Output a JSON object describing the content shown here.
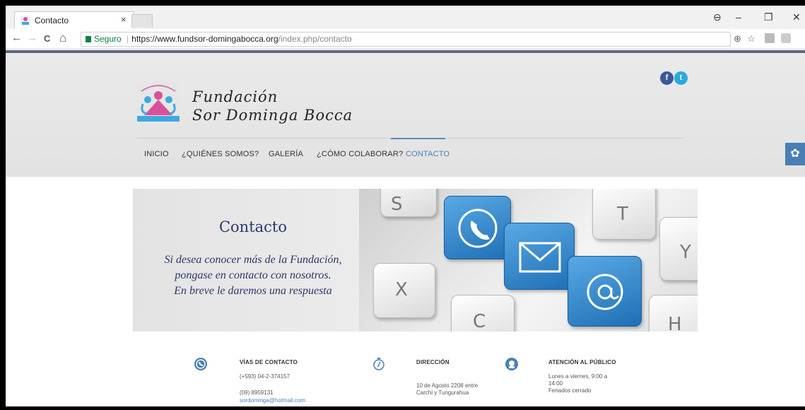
{
  "browser": {
    "tab_title": "Contacto",
    "tab_close": "×",
    "win_controls": {
      "profile": "⊖",
      "minimize": "–",
      "restore": "❐",
      "close": "✕"
    },
    "nav": {
      "back": "←",
      "forward": "→",
      "reload": "C",
      "home": "⌂"
    },
    "secure_label": "Seguro",
    "url_host": "https://www.fundsor-domingabocca.org",
    "url_path": "/index.php/contacto",
    "toolbar_icons": {
      "zoom": "⊕",
      "star": "☆"
    }
  },
  "site": {
    "brand_line1": "Fundación",
    "brand_line2": "Sor Dominga Bocca",
    "social": {
      "facebook": "f",
      "twitter": "t"
    },
    "nav": [
      {
        "label": "INICIO",
        "active": false
      },
      {
        "label": "¿QUIÉNES SOMOS?",
        "active": false
      },
      {
        "label": "GALERÍA",
        "active": false
      },
      {
        "label": "¿CÓMO COLABORAR?",
        "active": false
      },
      {
        "label": "CONTACTO",
        "active": true
      }
    ],
    "gear": "✿"
  },
  "banner": {
    "title": "Contacto",
    "line1": "Si desea conocer más de la Fundación,",
    "line2": "pongase en contacto con nosotros.",
    "line3": "En breve le daremos una respuesta",
    "keys": [
      "S",
      "T",
      "Y",
      "X",
      "C",
      "H"
    ]
  },
  "info": {
    "contact": {
      "heading": "VÍAS DE CONTACTO",
      "phone1": "(+593) 04-2-374157",
      "phone2": "(09) 8959131",
      "email": "sordominga@hotmail.com"
    },
    "address": {
      "heading": "DIRECCIÓN",
      "line1": "10 de Agosto 2208 entre",
      "line2": "Carchi y Tungurahua"
    },
    "hours": {
      "heading": "ATENCIÓN AL PÚBLICO",
      "line1": "Lunes a viernes, 9:00 a",
      "line2": "14:00",
      "line3": "Feriados cerrado"
    }
  },
  "colors": {
    "accent": "#4a7fb6",
    "brand_navy": "#273a6b",
    "secure_green": "#0b8043"
  }
}
